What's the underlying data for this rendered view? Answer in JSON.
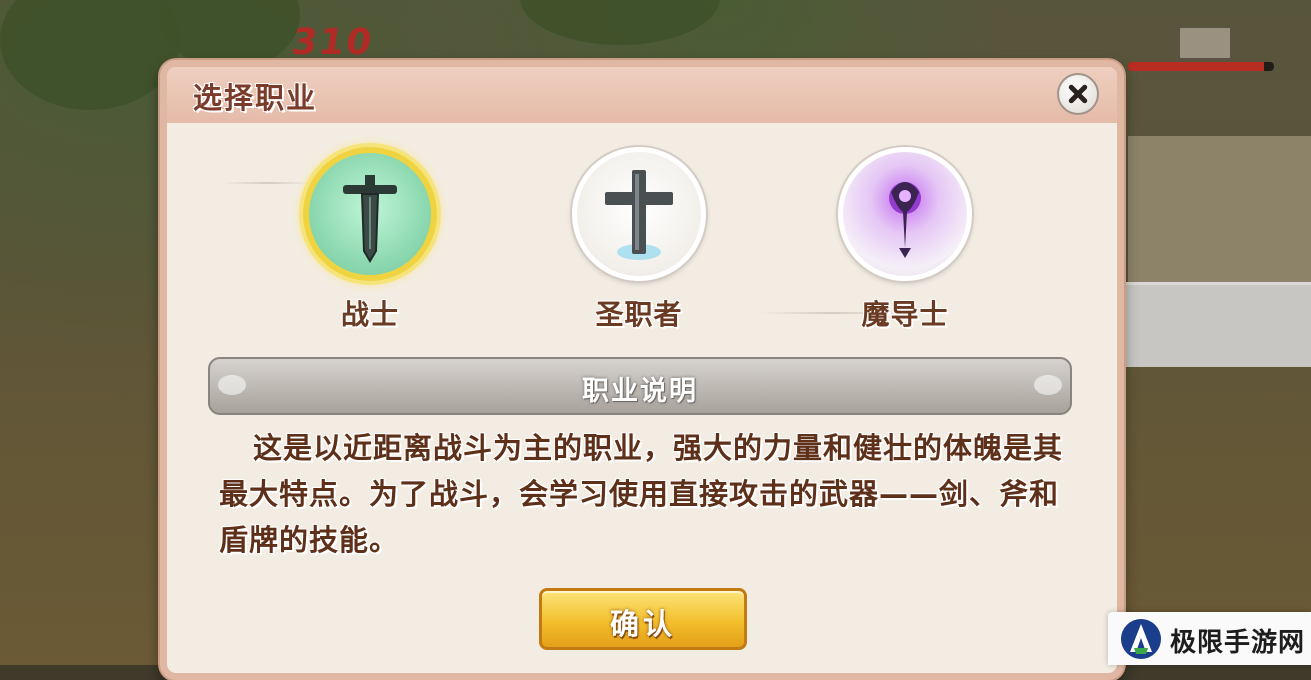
{
  "hud": {
    "number": "310",
    "health_fraction": 0.93,
    "health_color": "#b82d22"
  },
  "dialog": {
    "title": "选择职业",
    "close_icon": "close-x-icon"
  },
  "classes": [
    {
      "label": "战士",
      "icon": "sword-icon",
      "selected": true
    },
    {
      "label": "圣职者",
      "icon": "holy-cross-icon",
      "selected": false
    },
    {
      "label": "魔导士",
      "icon": "magic-staff-icon",
      "selected": false
    }
  ],
  "description": {
    "header": "职业说明",
    "text": "这是以近距离战斗为主的职业，强大的力量和健壮的体魄是其最大特点。为了战斗，会学习使用直接攻击的武器——剑、斧和盾牌的技能。"
  },
  "confirm": {
    "label": "确认"
  },
  "watermark": {
    "text": "极限手游网"
  },
  "colors": {
    "dialog_border": "#e0b7a3",
    "selected_ring": "#f0d340",
    "confirm_button": "#f3bf2c",
    "text_brown": "#5e2f19"
  }
}
